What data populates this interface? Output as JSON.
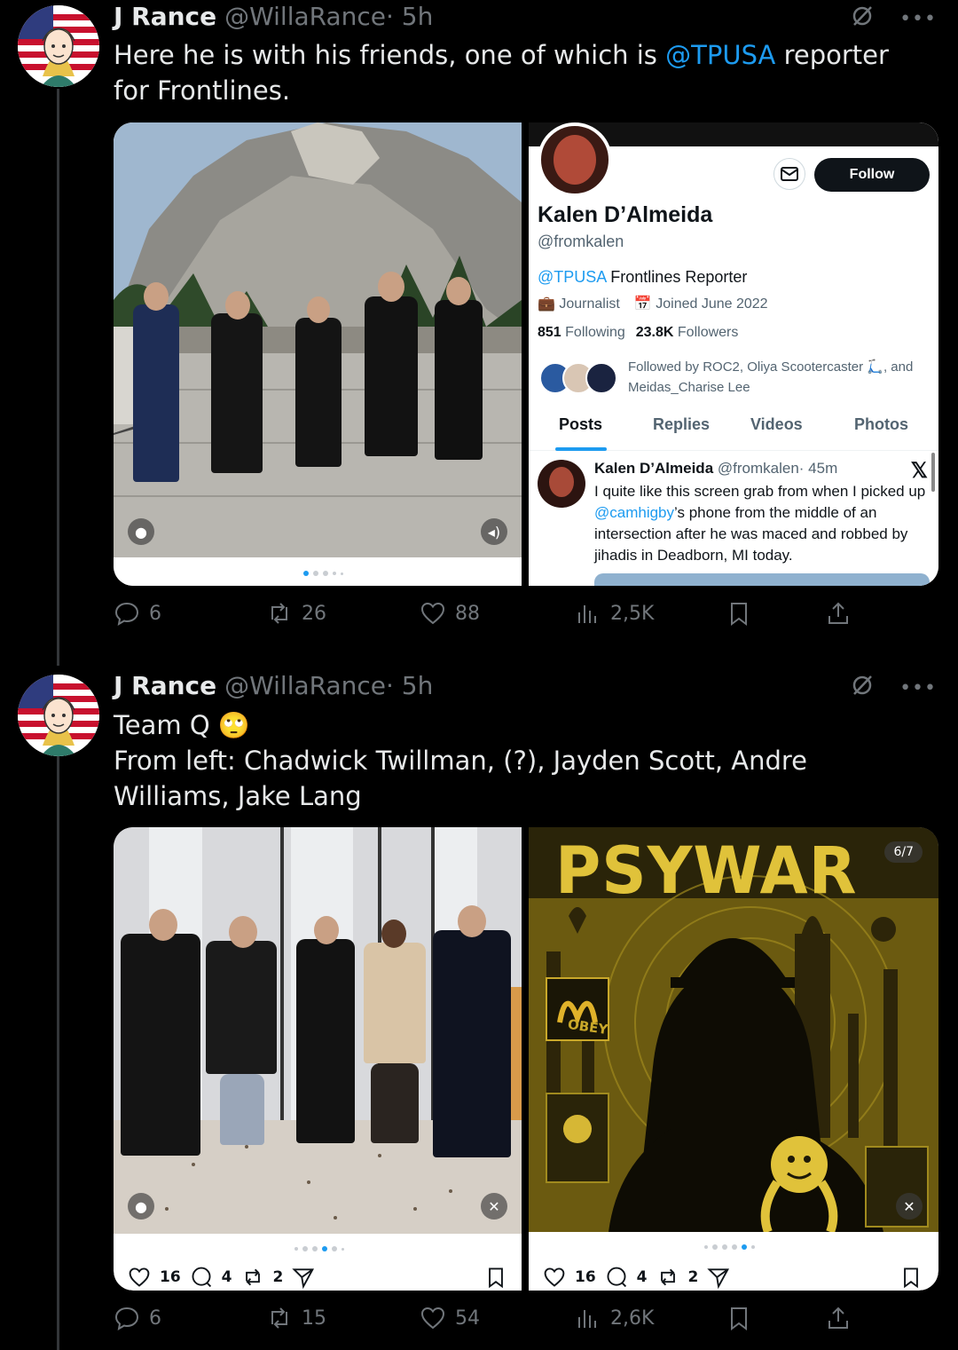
{
  "tweets": [
    {
      "author_name": "J Rance",
      "author_handle": "@WillaRance",
      "time": "· 5h",
      "text_before": "Here he is with his friends, one of which is ",
      "mention": "@TPUSA",
      "text_after": " reporter for Frontlines.",
      "actions": {
        "replies": "6",
        "reposts": "26",
        "likes": "88",
        "views": "2,5K"
      },
      "profile_card": {
        "name": "Kalen D’Almeida",
        "handle": "@fromkalen",
        "follow_label": "Follow",
        "bio_mention": "@TPUSA",
        "bio_rest": " Frontlines Reporter",
        "category": "Journalist",
        "joined": "Joined June 2022",
        "following_count": "851",
        "following_label": "Following",
        "followers_count": "23.8K",
        "followers_label": "Followers",
        "followed_by": "Followed by ROC2, Oliya Scootercaster 🛴, and Meidas_Charise Lee",
        "tabs": [
          "Posts",
          "Replies",
          "Videos",
          "Photos"
        ],
        "post": {
          "name": "Kalen D’Almeida",
          "handle": "@fromkalen",
          "time": "· 45m",
          "text_1": "I quite like this screen grab from when I picked up ",
          "mention": "@camhigby",
          "text_2": "’s phone from the middle of an intersection after he was maced and robbed by jihadis in Deadborn, MI today."
        }
      }
    },
    {
      "author_name": "J Rance",
      "author_handle": "@WillaRance",
      "time": "· 5h",
      "line1": "Team Q 🙄",
      "line2": "From left: Chadwick Twillman, (?), Jayden Scott, Andre Williams, Jake Lang",
      "actions": {
        "replies": "6",
        "reposts": "15",
        "likes": "54",
        "views": "2,6K"
      },
      "left_card": {
        "likes": "16",
        "comments": "4",
        "reposts": "2"
      },
      "right_card": {
        "likes": "16",
        "comments": "4",
        "reposts": "2",
        "counter": "6/7",
        "poster_title": "PSYWAR",
        "sign": "OBEY"
      }
    }
  ],
  "icons": [
    "mute-icon",
    "more-icon",
    "reply-icon",
    "repost-icon",
    "like-icon",
    "views-icon",
    "bookmark-icon",
    "share-icon"
  ],
  "colors": {
    "background": "#000000",
    "accent": "#1d9bf0",
    "muted": "#71767b",
    "psywar_yellow": "#e0c23a"
  }
}
